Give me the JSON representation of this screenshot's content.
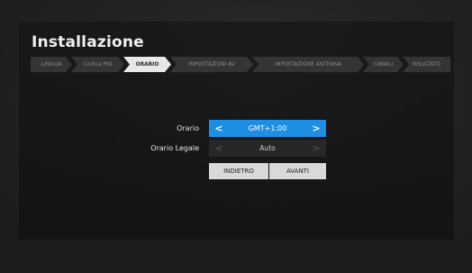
{
  "title": "Installazione",
  "steps": [
    {
      "label": "LINGUA",
      "state": "inactive"
    },
    {
      "label": "Codice PIN",
      "state": "inactive"
    },
    {
      "label": "ORARIO",
      "state": "active"
    },
    {
      "label": "IMPOSTAZIONI AV",
      "state": "inactive"
    },
    {
      "label": "IMPOSTAZIONE ANTENNA",
      "state": "inactive"
    },
    {
      "label": "CANALI",
      "state": "inactive"
    },
    {
      "label": "RISULTATO",
      "state": "inactive"
    }
  ],
  "form": {
    "orario": {
      "label": "Orario",
      "value": "GMT+1:00",
      "focused": true
    },
    "orario_legale": {
      "label": "Orario Legale",
      "value": "Auto",
      "focused": false
    }
  },
  "buttons": {
    "back": "INDIETRO",
    "next": "AVANTI"
  },
  "icons": {
    "prev": "chevron-left-icon",
    "next": "chevron-right-icon"
  },
  "colors": {
    "accent": "#1e8ee3",
    "button_bg": "#d9d9d9",
    "step_active": "#e8e8e8",
    "step_inactive": "#343434"
  }
}
